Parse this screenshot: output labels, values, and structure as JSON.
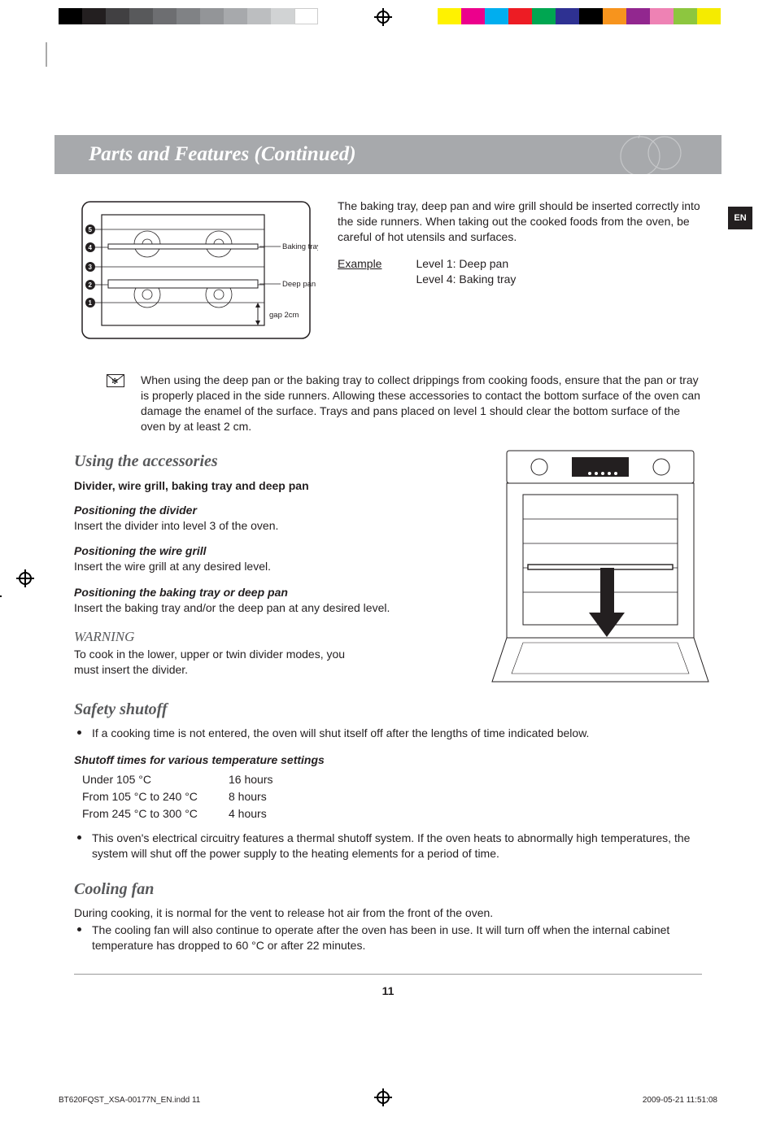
{
  "header": {
    "title": "Parts and Features (Continued)"
  },
  "lang_tab": "EN",
  "diagram_labels": {
    "baking_tray": "Baking tray",
    "deep_pan": "Deep pan",
    "gap": "gap 2cm",
    "levels": [
      "1",
      "2",
      "3",
      "4",
      "5"
    ]
  },
  "intro_text": "The baking tray, deep pan and wire grill should be inserted correctly into the side runners. When taking out the cooked foods from the oven, be careful of hot utensils and surfaces.",
  "example": {
    "label": "Example",
    "line1": "Level 1: Deep pan",
    "line2": "Level 4: Baking tray"
  },
  "note": "When using the deep pan or the baking tray to collect drippings from cooking foods, ensure that the pan or tray is properly placed in the side runners. Allowing these accessories to contact the bottom surface of the oven can damage the enamel of the surface. Trays and pans placed on level 1 should clear the bottom surface of the oven by at least 2 cm.",
  "accessories": {
    "heading": "Using the accessories",
    "sub": "Divider, wire grill, baking tray and deep pan",
    "divider_h": "Positioning the divider",
    "divider_t": "Insert the divider into level 3 of the oven.",
    "grill_h": "Positioning the wire grill",
    "grill_t": "Insert the wire grill at any desired level.",
    "tray_h": "Positioning the baking tray or deep pan",
    "tray_t": "Insert the baking tray and/or the deep pan at any desired level.",
    "warning_h": "WARNING",
    "warning_t": "To cook in the lower, upper or twin divider modes, you must insert the divider."
  },
  "safety": {
    "heading": "Safety shutoff",
    "bullet1": "If a cooking time is not entered, the oven will shut itself off after the lengths of time indicated below.",
    "table_h": "Shutoff times for various temperature settings",
    "rows": [
      {
        "range": "Under 105 °C",
        "time": "16 hours"
      },
      {
        "range": "From 105 °C to 240 °C",
        "time": "8 hours"
      },
      {
        "range": "From 245 °C to 300 °C",
        "time": "4 hours"
      }
    ],
    "bullet2": "This oven's electrical circuitry features a thermal shutoff system. If the oven heats to abnormally high temperatures, the system will shut off the power supply to the heating elements for a period of time."
  },
  "cooling": {
    "heading": "Cooling fan",
    "line1": "During cooking, it is normal for the vent to release hot air from the front of the oven.",
    "bullet": "The cooling fan will also continue to operate after the oven has been in use. It will turn off when the internal cabinet temperature has dropped to 60 °C or after 22 minutes."
  },
  "page_number": "11",
  "footer": {
    "file": "BT620FQST_XSA-00177N_EN.indd   11",
    "timestamp": "2009-05-21     11:51:08"
  },
  "print_bar": {
    "grays": [
      "#000000",
      "#231f20",
      "#414042",
      "#58595b",
      "#6d6e71",
      "#808285",
      "#939598",
      "#a7a9ac",
      "#bcbec0",
      "#d1d3d4",
      "#ffffff"
    ],
    "colors": [
      "#fff200",
      "#ec008c",
      "#00aeef",
      "#ed1c24",
      "#00a651",
      "#2e3192",
      "#000000",
      "#f7941d",
      "#92278f",
      "#ee82b4",
      "#8dc63f",
      "#f5eb00"
    ]
  }
}
